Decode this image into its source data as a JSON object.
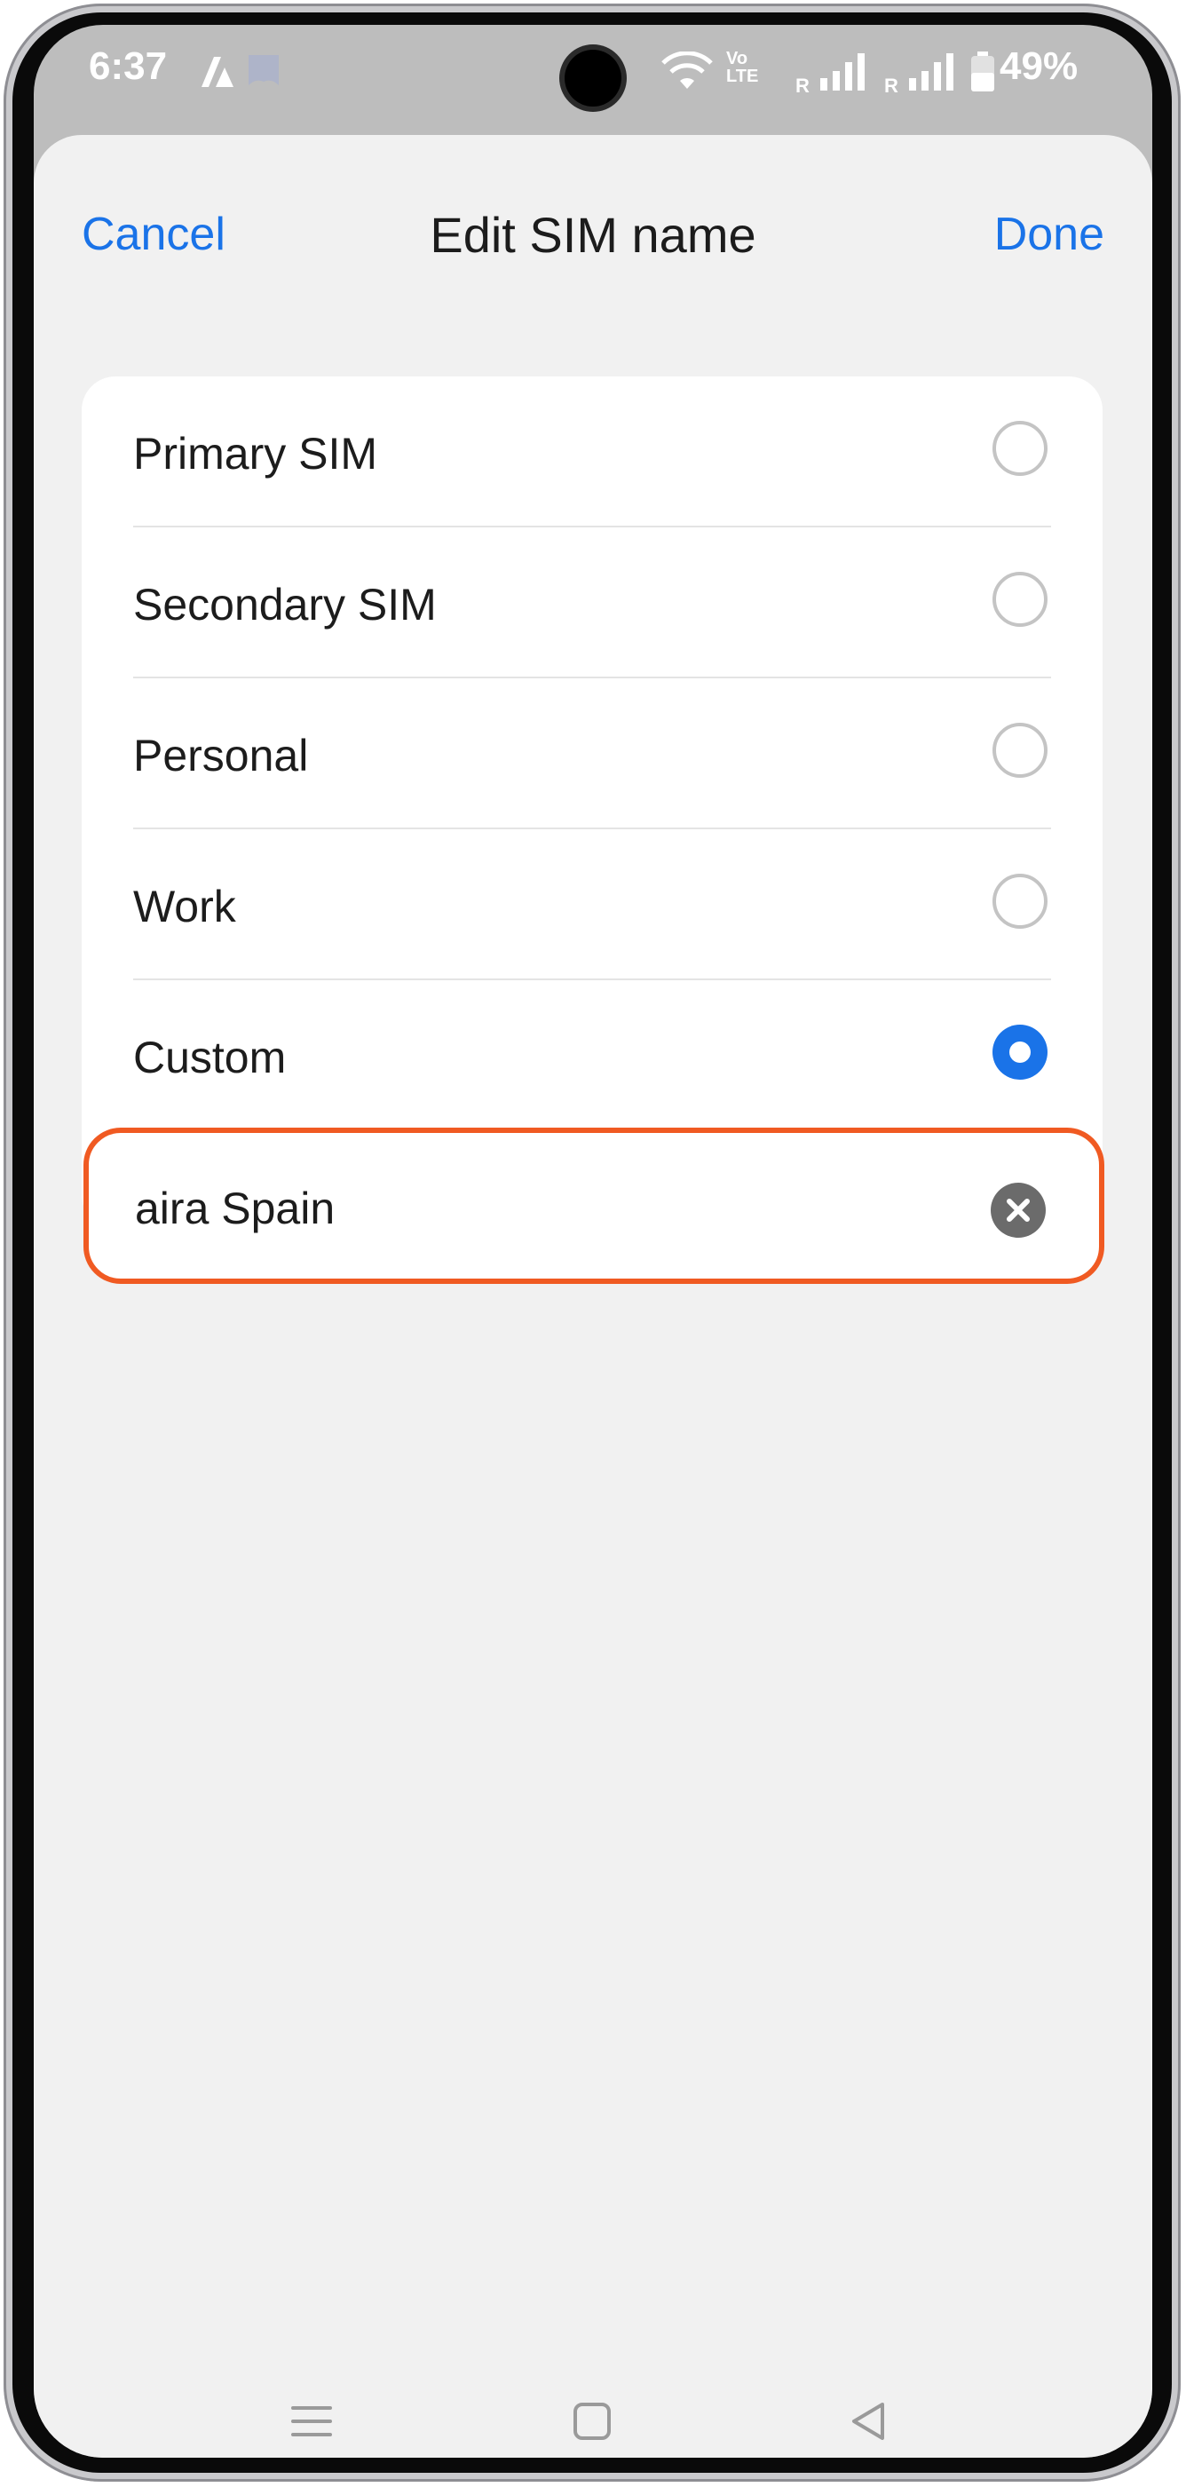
{
  "status_bar": {
    "time": "6:37",
    "notification_icons": [
      "app-a-icon",
      "app-b-icon"
    ],
    "network_label": "Vo LTE",
    "roaming_1": "R",
    "roaming_2": "R",
    "battery": "49%"
  },
  "header": {
    "cancel_label": "Cancel",
    "title": "Edit SIM name",
    "done_label": "Done"
  },
  "options": [
    {
      "label": "Primary SIM",
      "selected": false
    },
    {
      "label": "Secondary SIM",
      "selected": false
    },
    {
      "label": "Personal",
      "selected": false
    },
    {
      "label": "Work",
      "selected": false
    },
    {
      "label": "Custom",
      "selected": true
    }
  ],
  "custom_input": {
    "value": "aira Spain"
  },
  "nav_bar": {
    "icons": [
      "recent-apps-icon",
      "home-icon",
      "back-icon"
    ]
  },
  "colors": {
    "accent": "#1a73e8",
    "highlight_border": "#f05a22",
    "sheet_background": "#f1f1f1"
  }
}
